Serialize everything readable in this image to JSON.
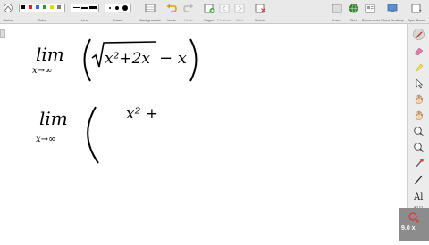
{
  "toolbar": {
    "status_label": "Status",
    "color_label": "Color",
    "line_label": "Line",
    "eraser_label": "Eraser",
    "backgrounds_label": "Backgrounds",
    "undo_label": "Undo",
    "redo_label": "Redo",
    "pages_label": "Pages",
    "previous_label": "Previous",
    "next_label": "Next",
    "delete_label": "Delete",
    "insert_label": "Insert",
    "web_label": "Web",
    "documents_label": "Documents",
    "show_desktop_label": "Show Desktop",
    "openboard_label": "OpenBoard",
    "colors": [
      "#000000",
      "#e02020",
      "#2f6fde",
      "#25a025",
      "#e6d21c",
      "#7a7a7a"
    ]
  },
  "right_tools": [
    "pen-icon",
    "eraser-icon",
    "highlighter-icon",
    "pointer-icon",
    "hand-icon",
    "hand-icon",
    "zoom-in-icon",
    "zoom-out-icon",
    "laser-pointer-icon",
    "line-icon",
    "text-tool-icon",
    "capture-icon"
  ],
  "board": {
    "expr1": {
      "lim": "lim",
      "sub": "x→∞",
      "radicand": "x²+2x",
      "rest": "− x"
    },
    "expr2": {
      "lim": "lim",
      "sub": "x→∞",
      "partial": "x² +"
    }
  },
  "video": {
    "zoom": "9.0 x"
  }
}
